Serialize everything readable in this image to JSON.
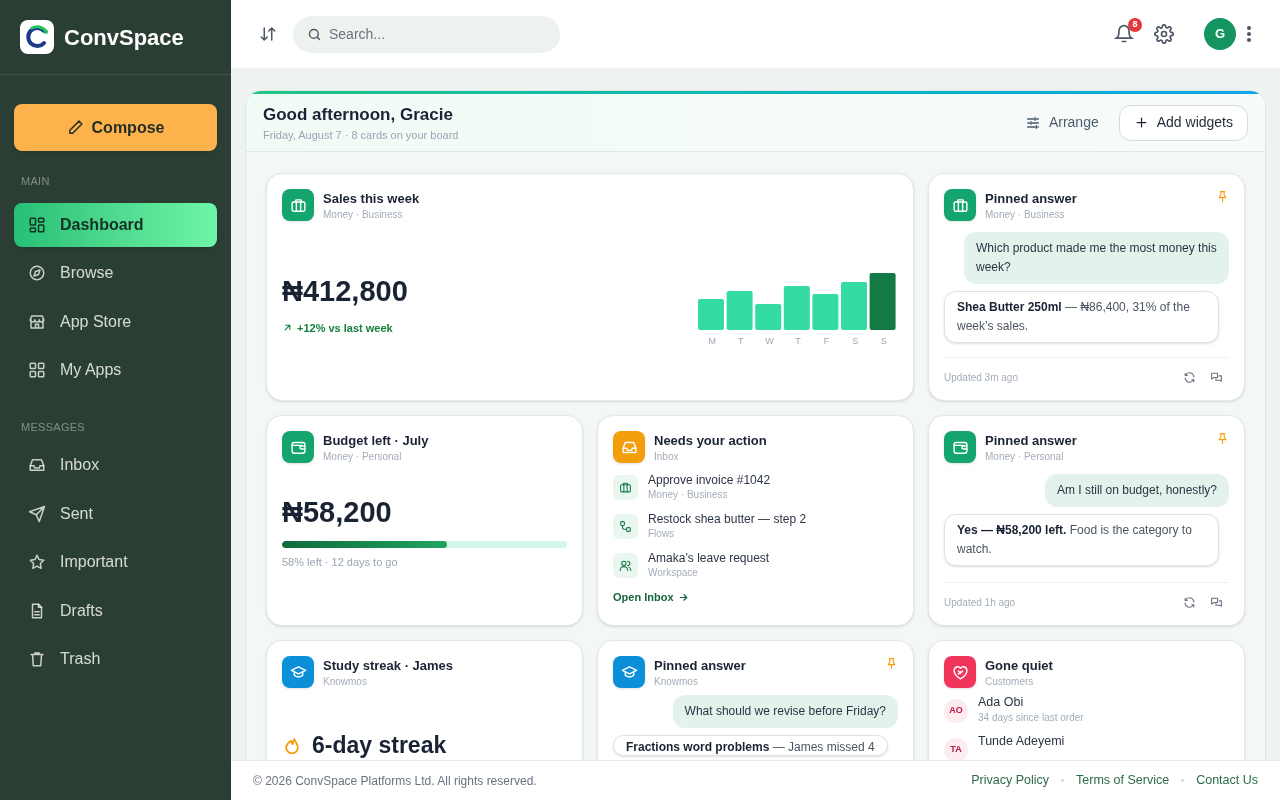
{
  "brand": {
    "name": "ConvSpace"
  },
  "compose": {
    "label": "Compose"
  },
  "nav_sections": [
    {
      "title": "MAIN",
      "items": [
        {
          "label": "Dashboard",
          "selected": true
        },
        {
          "label": "Browse",
          "selected": false
        },
        {
          "label": "App Store",
          "selected": false
        },
        {
          "label": "My Apps",
          "selected": false
        }
      ]
    },
    {
      "title": "MESSAGES",
      "items": [
        {
          "label": "Inbox",
          "selected": false
        },
        {
          "label": "Sent",
          "selected": false
        },
        {
          "label": "Important",
          "selected": false
        },
        {
          "label": "Drafts",
          "selected": false
        },
        {
          "label": "Trash",
          "selected": false
        }
      ]
    }
  ],
  "header": {
    "search": {
      "placeholder": "Search..."
    },
    "notifications": "8",
    "avatar": "G"
  },
  "board": {
    "title": "Good afternoon, Gracie",
    "subtitle": "Friday, August 7 · 8 cards on your board",
    "arrange": "Arrange",
    "add": "Add widgets"
  },
  "cards": [
    {
      "kind": "sales",
      "title": "Sales this week",
      "subtitle": "Money · Business",
      "color": "#14a56f",
      "amount": "₦412,800",
      "delta": "+12% vs last week",
      "day_labels": [
        "M",
        "T",
        "W",
        "T",
        "F",
        "S",
        "S"
      ]
    },
    {
      "kind": "pinned",
      "title": "Pinned answer",
      "subtitle": "Money · Business",
      "color": "#14a56f",
      "question": "Which product made me the most money this week?",
      "answer": "**Shea Butter 250ml** — ₦86,400, 31% of the week’s sales.",
      "updated": "Updated 3m ago"
    },
    {
      "kind": "budget",
      "title": "Budget left · July",
      "subtitle": "Money · Personal",
      "color": "#14a56f",
      "amount": "₦58,200",
      "level": 0.58,
      "note": "58% left · 12 days to go"
    },
    {
      "kind": "actions",
      "title": "Needs your action",
      "subtitle": "Inbox",
      "color": "#f59e0b",
      "items": [
        {
          "title": "Approve invoice #1042",
          "subtitle": "Money · Business"
        },
        {
          "title": "Restock shea butter — step 2",
          "subtitle": "Flows"
        },
        {
          "title": "Amaka’s leave request",
          "subtitle": "Workspace"
        }
      ],
      "link": "Open Inbox"
    },
    {
      "kind": "pinned",
      "title": "Pinned answer",
      "subtitle": "Money · Personal",
      "color": "#14a56f",
      "question": "Am I still on budget, honestly?",
      "answer": "**Yes — ₦58,200 left.** Food is the category to watch.",
      "updated": "Updated 1h ago"
    },
    {
      "kind": "streak",
      "title": "Study streak · James",
      "subtitle": "Knowmos",
      "color": "#0a8fd8",
      "streak": "6-day streak"
    },
    {
      "kind": "pinned",
      "title": "Pinned answer",
      "subtitle": "Knowmos",
      "color": "#0a8fd8",
      "question": "What should we revise before Friday?",
      "answer": "**Fractions word problems** — James missed 4"
    },
    {
      "kind": "customers",
      "title": "Gone quiet",
      "subtitle": "Customers",
      "color": "#f0355a",
      "people": [
        {
          "initials": "AO",
          "name": "Ada Obi",
          "note": "34 days since last order"
        },
        {
          "initials": "TA",
          "name": "Tunde Adeyemi"
        }
      ]
    }
  ],
  "footer": {
    "copyright": "© 2026 ConvSpace Platforms Ltd. All rights reserved.",
    "links": [
      "Privacy Policy",
      "Terms of Service",
      "Contact Us"
    ]
  }
}
